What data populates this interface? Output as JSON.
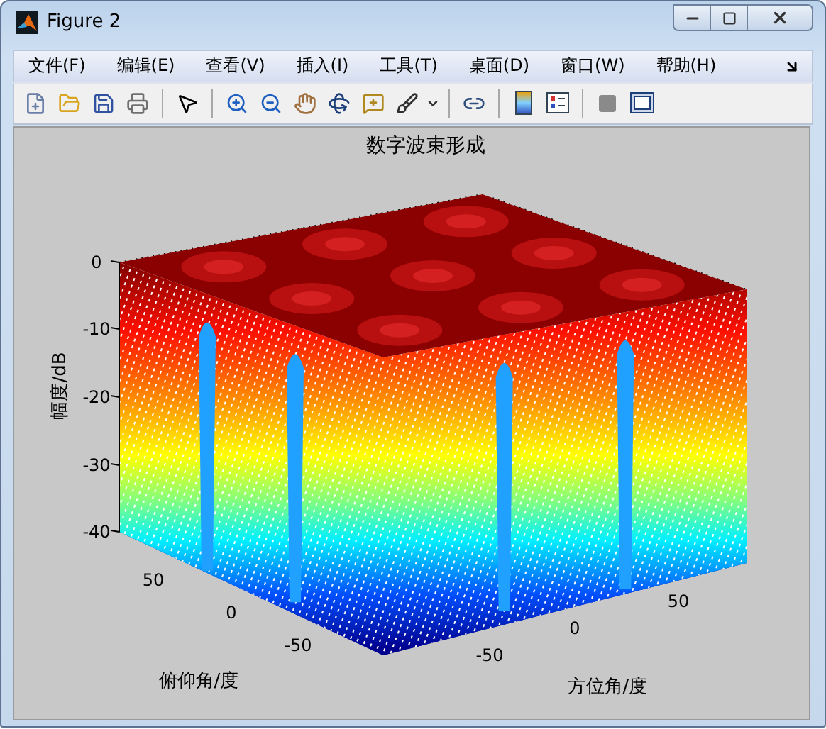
{
  "window": {
    "title": "Figure 2"
  },
  "menu": [
    "文件(F)",
    "编辑(E)",
    "查看(V)",
    "插入(I)",
    "工具(T)",
    "桌面(D)",
    "窗口(W)",
    "帮助(H)"
  ],
  "figure": {
    "title": "数字波束形成",
    "zlabel": "幅度/dB",
    "ylabel": "俯仰角/度",
    "xlabel": "方位角/度",
    "zticks": [
      "0",
      "-10",
      "-20",
      "-30",
      "-40"
    ],
    "yticks": [
      "50",
      "0",
      "-50"
    ],
    "xticks": [
      "-50",
      "0",
      "50"
    ]
  }
}
